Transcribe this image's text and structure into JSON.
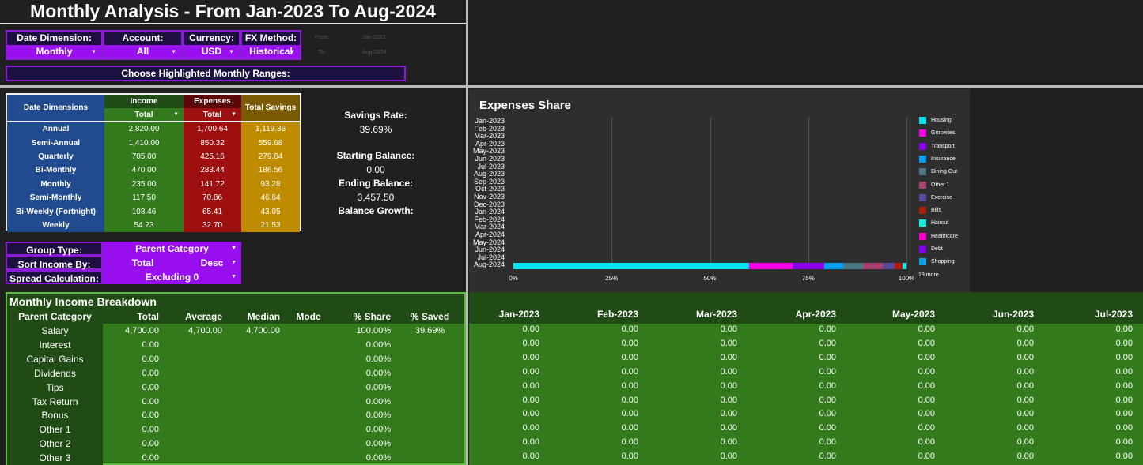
{
  "title": "Monthly Analysis - From Jan-2023 To Aug-2024",
  "controls": {
    "date_dimension": {
      "label": "Date Dimension:",
      "value": "Monthly"
    },
    "account": {
      "label": "Account:",
      "value": "All"
    },
    "currency": {
      "label": "Currency:",
      "value": "USD"
    },
    "fx_method": {
      "label": "FX Method:",
      "value": "Historical"
    },
    "from_label": "From:",
    "from_value": "Jan-2023",
    "to_label": "To:",
    "to_value": "Aug-2024",
    "highlight_button": "Choose Highlighted Monthly Ranges:"
  },
  "date_dims": {
    "header_dim": "Date Dimensions",
    "header_income": "Income",
    "header_expenses": "Expenses",
    "header_savings": "Total Savings",
    "income_select": "Total",
    "expenses_select": "Total",
    "rows": [
      {
        "dim": "Annual",
        "income": "2,820.00",
        "expenses": "1,700.64",
        "savings": "1,119.36"
      },
      {
        "dim": "Semi-Annual",
        "income": "1,410.00",
        "expenses": "850.32",
        "savings": "559.68"
      },
      {
        "dim": "Quarterly",
        "income": "705.00",
        "expenses": "425.16",
        "savings": "279.84"
      },
      {
        "dim": "Bi-Monthly",
        "income": "470.00",
        "expenses": "283.44",
        "savings": "186.56"
      },
      {
        "dim": "Monthly",
        "income": "235.00",
        "expenses": "141.72",
        "savings": "93.28"
      },
      {
        "dim": "Semi-Monthly",
        "income": "117.50",
        "expenses": "70.86",
        "savings": "46.64"
      },
      {
        "dim": "Bi-Weekly (Fortnight)",
        "income": "108.46",
        "expenses": "65.41",
        "savings": "43.05"
      },
      {
        "dim": "Weekly",
        "income": "54.23",
        "expenses": "32.70",
        "savings": "21.53"
      }
    ]
  },
  "stats": {
    "savings_rate_label": "Savings Rate:",
    "savings_rate": "39.69%",
    "starting_balance_label": "Starting Balance:",
    "starting_balance": "0.00",
    "ending_balance_label": "Ending Balance:",
    "ending_balance": "3,457.50",
    "balance_growth_label": "Balance Growth:"
  },
  "group": {
    "group_type_label": "Group Type:",
    "group_type_value": "Parent Category",
    "sort_label": "Sort Income By:",
    "sort_value": "Total",
    "sort_dir": "Desc",
    "spread_label": "Spread Calculation:",
    "spread_value": "Excluding 0"
  },
  "chart": {
    "title": "Expenses Share",
    "more_label": "19 more"
  },
  "chart_data": {
    "type": "bar",
    "orientation": "horizontal-stacked-percent",
    "title": "Expenses Share",
    "categories": [
      "Jan-2023",
      "Feb-2023",
      "Mar-2023",
      "Apr-2023",
      "May-2023",
      "Jun-2023",
      "Jul-2023",
      "Aug-2023",
      "Sep-2023",
      "Oct-2023",
      "Nov-2023",
      "Dec-2023",
      "Jan-2024",
      "Feb-2024",
      "Mar-2024",
      "Apr-2024",
      "May-2024",
      "Jun-2024",
      "Jul-2024",
      "Aug-2024"
    ],
    "x_ticks": [
      "0%",
      "25%",
      "50%",
      "75%",
      "100%"
    ],
    "xlim": [
      0,
      100
    ],
    "legend_position": "right",
    "series": [
      {
        "name": "Housing",
        "color": "#00e5ee",
        "values": [
          0,
          0,
          0,
          0,
          0,
          0,
          0,
          0,
          0,
          0,
          0,
          0,
          0,
          0,
          0,
          0,
          0,
          0,
          0,
          60
        ]
      },
      {
        "name": "Groceries",
        "color": "#ff00e6",
        "values": [
          0,
          0,
          0,
          0,
          0,
          0,
          0,
          0,
          0,
          0,
          0,
          0,
          0,
          0,
          0,
          0,
          0,
          0,
          0,
          11
        ]
      },
      {
        "name": "Transport",
        "color": "#8b00f5",
        "values": [
          0,
          0,
          0,
          0,
          0,
          0,
          0,
          0,
          0,
          0,
          0,
          0,
          0,
          0,
          0,
          0,
          0,
          0,
          0,
          8
        ]
      },
      {
        "name": "Insurance",
        "color": "#00a0f0",
        "values": [
          0,
          0,
          0,
          0,
          0,
          0,
          0,
          0,
          0,
          0,
          0,
          0,
          0,
          0,
          0,
          0,
          0,
          0,
          0,
          5
        ]
      },
      {
        "name": "Dining Out",
        "color": "#4a7b86",
        "values": [
          0,
          0,
          0,
          0,
          0,
          0,
          0,
          0,
          0,
          0,
          0,
          0,
          0,
          0,
          0,
          0,
          0,
          0,
          0,
          5
        ]
      },
      {
        "name": "Other 1",
        "color": "#a8426e",
        "values": [
          0,
          0,
          0,
          0,
          0,
          0,
          0,
          0,
          0,
          0,
          0,
          0,
          0,
          0,
          0,
          0,
          0,
          0,
          0,
          5
        ]
      },
      {
        "name": "Exercise",
        "color": "#5d4a9e",
        "values": [
          0,
          0,
          0,
          0,
          0,
          0,
          0,
          0,
          0,
          0,
          0,
          0,
          0,
          0,
          0,
          0,
          0,
          0,
          0,
          3
        ]
      },
      {
        "name": "Bills",
        "color": "#b01c0c",
        "values": [
          0,
          0,
          0,
          0,
          0,
          0,
          0,
          0,
          0,
          0,
          0,
          0,
          0,
          0,
          0,
          0,
          0,
          0,
          0,
          2
        ]
      },
      {
        "name": "Haircut",
        "color": "#18e8e0",
        "values": [
          0,
          0,
          0,
          0,
          0,
          0,
          0,
          0,
          0,
          0,
          0,
          0,
          0,
          0,
          0,
          0,
          0,
          0,
          0,
          1
        ]
      },
      {
        "name": "Healthcare",
        "color": "#ff00d4",
        "values": [
          0,
          0,
          0,
          0,
          0,
          0,
          0,
          0,
          0,
          0,
          0,
          0,
          0,
          0,
          0,
          0,
          0,
          0,
          0,
          0
        ]
      },
      {
        "name": "Debt",
        "color": "#8000ef",
        "values": [
          0,
          0,
          0,
          0,
          0,
          0,
          0,
          0,
          0,
          0,
          0,
          0,
          0,
          0,
          0,
          0,
          0,
          0,
          0,
          0
        ]
      },
      {
        "name": "Shopping",
        "color": "#0ba2e8",
        "values": [
          0,
          0,
          0,
          0,
          0,
          0,
          0,
          0,
          0,
          0,
          0,
          0,
          0,
          0,
          0,
          0,
          0,
          0,
          0,
          0
        ]
      }
    ]
  },
  "income_breakdown": {
    "title": "Monthly Income Breakdown",
    "headers": [
      "Parent Category",
      "Total",
      "Average",
      "Median",
      "Mode",
      "% Share",
      "% Saved"
    ],
    "rows": [
      {
        "cat": "Salary",
        "total": "4,700.00",
        "avg": "4,700.00",
        "med": "4,700.00",
        "mode": "",
        "share": "100.00%",
        "saved": "39.69%"
      },
      {
        "cat": "Interest",
        "total": "0.00",
        "avg": "",
        "med": "",
        "mode": "",
        "share": "0.00%",
        "saved": ""
      },
      {
        "cat": "Capital Gains",
        "total": "0.00",
        "avg": "",
        "med": "",
        "mode": "",
        "share": "0.00%",
        "saved": ""
      },
      {
        "cat": "Dividends",
        "total": "0.00",
        "avg": "",
        "med": "",
        "mode": "",
        "share": "0.00%",
        "saved": ""
      },
      {
        "cat": "Tips",
        "total": "0.00",
        "avg": "",
        "med": "",
        "mode": "",
        "share": "0.00%",
        "saved": ""
      },
      {
        "cat": "Tax Return",
        "total": "0.00",
        "avg": "",
        "med": "",
        "mode": "",
        "share": "0.00%",
        "saved": ""
      },
      {
        "cat": "Bonus",
        "total": "0.00",
        "avg": "",
        "med": "",
        "mode": "",
        "share": "0.00%",
        "saved": ""
      },
      {
        "cat": "Other 1",
        "total": "0.00",
        "avg": "",
        "med": "",
        "mode": "",
        "share": "0.00%",
        "saved": ""
      },
      {
        "cat": "Other 2",
        "total": "0.00",
        "avg": "",
        "med": "",
        "mode": "",
        "share": "0.00%",
        "saved": ""
      },
      {
        "cat": "Other 3",
        "total": "0.00",
        "avg": "",
        "med": "",
        "mode": "",
        "share": "0.00%",
        "saved": ""
      }
    ]
  },
  "monthly": {
    "months": [
      "Jan-2023",
      "Feb-2023",
      "Mar-2023",
      "Apr-2023",
      "May-2023",
      "Jun-2023",
      "Jul-2023"
    ],
    "cell_value": "0.00",
    "row_count": 10
  }
}
